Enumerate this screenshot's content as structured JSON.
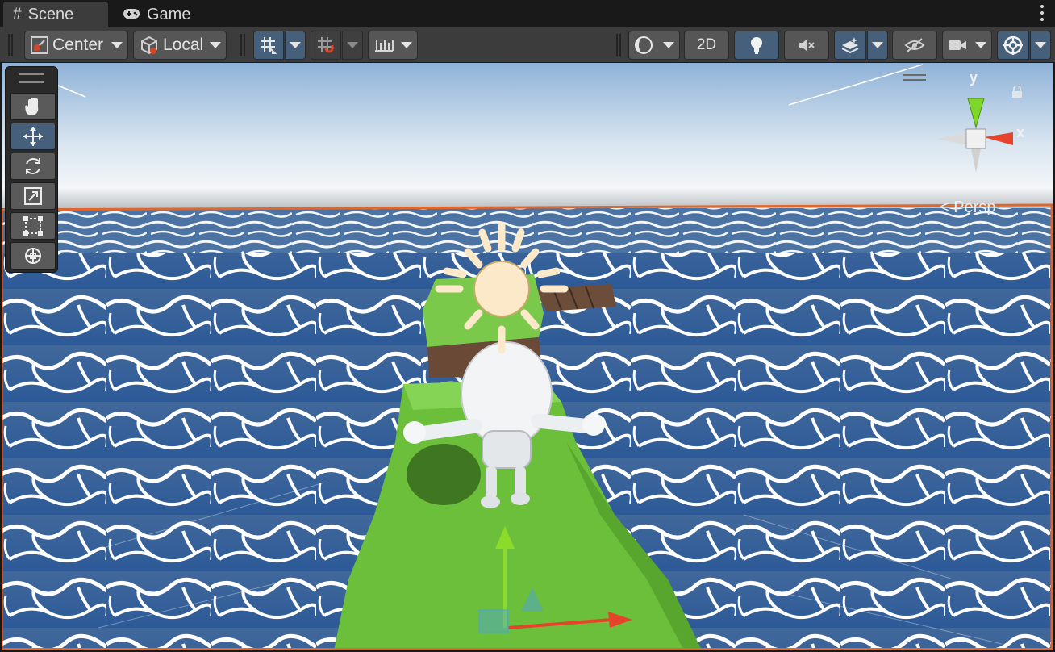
{
  "tabs": [
    {
      "label": "Scene",
      "icon": "grid-hash-icon",
      "active": true
    },
    {
      "label": "Game",
      "icon": "gamepad-icon",
      "active": false
    }
  ],
  "toolbar": {
    "pivot_mode": "Center",
    "pivot_rotation": "Local",
    "mode_2d_label": "2D",
    "active_color": "#46607c",
    "button_color": "#565656"
  },
  "tools_palette": [
    "hand-tool",
    "move-tool",
    "rotate-tool",
    "scale-tool",
    "rect-tool",
    "transform-tool"
  ],
  "active_tool": "move-tool",
  "gizmo": {
    "y_label": "y",
    "x_label": "x",
    "projection_label": "Persp",
    "y_color": "#7fd62a",
    "x_color": "#e6442a"
  },
  "scene": {
    "sky_top": "#8fb2d8",
    "horizon": "#f4f6f8",
    "water": "#2f5f9c",
    "grass": "#6bbf3a",
    "selection_outline": "#e0662a"
  }
}
